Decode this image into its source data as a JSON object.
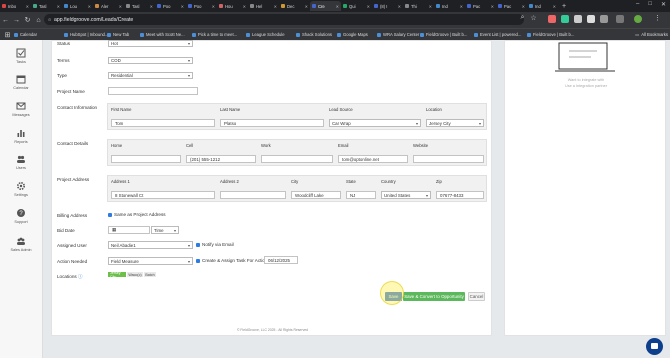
{
  "browser": {
    "tabs": [
      "Inbo",
      "Tasl",
      "Lou",
      "Aler",
      "Tasl",
      "Poo",
      "Poo",
      "Hou",
      "Hel",
      "Dec",
      "Cre",
      "Qui",
      "(8) I",
      "Thi",
      "Ind",
      "Pac",
      "Pac",
      "Ind"
    ],
    "active_tab_index": 10,
    "url": "app.fieldgroove.com/Leads/Create",
    "bookmarks": [
      "Calendar",
      "HubSpot | Inbound...",
      "New Tab",
      "Meet with Scott Ne...",
      "Pick a time to meet...",
      "League Schedule",
      "Shack Solutions",
      "Google Maps",
      "WRA Salary Center",
      "FieldGroove | Built b...",
      "Event List | powered...",
      "FieldGroove | Built b..."
    ],
    "all_bookmarks": "All Bookmarks",
    "accent": "#1f2023"
  },
  "sidebar": {
    "items": [
      {
        "label": "Tasks",
        "icon": "check-icon"
      },
      {
        "label": "Calendar",
        "icon": "calendar-icon"
      },
      {
        "label": "Messages",
        "icon": "message-icon"
      },
      {
        "label": "Reports",
        "icon": "bar-chart-icon"
      },
      {
        "label": "Users",
        "icon": "users-icon"
      },
      {
        "label": "Settings",
        "icon": "gear-icon"
      },
      {
        "label": "Support",
        "icon": "question-icon"
      },
      {
        "label": "Sales Admin",
        "icon": "team-icon"
      }
    ]
  },
  "form": {
    "status": {
      "label": "Status",
      "value": "Hot"
    },
    "terms": {
      "label": "Terms",
      "value": "COD"
    },
    "type": {
      "label": "Type",
      "value": "Residential"
    },
    "project_name": {
      "label": "Project Name",
      "value": ""
    },
    "contact_info": {
      "label": "Contact Information",
      "headers": [
        "First Name",
        "Last Name",
        "Lead Source",
        "Location"
      ],
      "values": [
        "Tom",
        "Platso",
        "Car Wrap",
        "Jersey City"
      ]
    },
    "contact_details": {
      "label": "Contact Details",
      "headers": [
        "Home",
        "Cell",
        "Work",
        "Email",
        "Website"
      ],
      "values": [
        "",
        "(201) 555-1212",
        "",
        "tom@optonline.net",
        ""
      ]
    },
    "project_address": {
      "label": "Project Address",
      "headers": [
        "Address 1",
        "Address 2",
        "City",
        "State",
        "Country",
        "Zip"
      ],
      "values": [
        "8 Stonewall Ct",
        "",
        "Woodcliff Lake",
        "NJ",
        "United States",
        "07677-8433"
      ]
    },
    "billing_address": {
      "label": "Billing Address",
      "checkbox_label": "Same as Project Address"
    },
    "bid_date": {
      "label": "Bid Date",
      "time": "Time"
    },
    "assigned_user": {
      "label": "Assigned User",
      "value": "Neil Abadie1",
      "notify_label": "Notify via Email"
    },
    "action_needed": {
      "label": "Action Needed",
      "value": "Field Measure",
      "task_label": "Create & Assign Task For Action?",
      "task_date": "06/12/2025"
    },
    "locations": {
      "label": "Locations",
      "chips": [
        "Jersey City",
        "Waco(c)",
        "Batch"
      ],
      "chip_colors": [
        "#6cc04a",
        "#e9e9e9",
        "#e9e9e9"
      ]
    },
    "buttons": {
      "save": "Save",
      "save_convert": "Save & Convert to Opportunity",
      "cancel": "Cancel"
    },
    "button_colors": {
      "save": "#2d6fd6",
      "save_convert": "#5cb85c"
    },
    "footer": "© FieldGroove, LLC 2025 - All Rights Reserved"
  },
  "right_panel": {
    "line1": "Want to integrate with",
    "line2": "Use a Integration partner"
  }
}
